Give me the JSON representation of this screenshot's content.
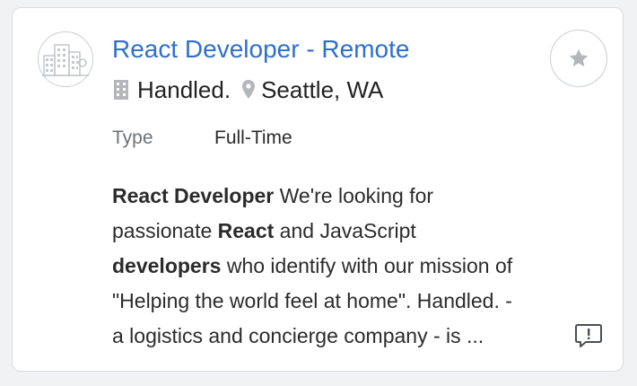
{
  "job": {
    "title": "React Developer - Remote",
    "company": "Handled.",
    "location": "Seattle, WA",
    "type_label": "Type",
    "type_value": "Full-Time",
    "description_lines": [
      [
        {
          "text": "React Developer",
          "bold": true
        },
        {
          "text": " We're looking for",
          "bold": false
        }
      ],
      [
        {
          "text": "passionate ",
          "bold": false
        },
        {
          "text": "React",
          "bold": true
        },
        {
          "text": " and JavaScript",
          "bold": false
        }
      ],
      [
        {
          "text": "developers",
          "bold": true
        },
        {
          "text": " who identify with our mission of",
          "bold": false
        }
      ],
      [
        {
          "text": "\"Helping the world feel at home\". Handled. -",
          "bold": false
        }
      ],
      [
        {
          "text": "a logistics and concierge company - is ...",
          "bold": false
        }
      ]
    ]
  },
  "icons": {
    "logo": "company-building-logo-icon",
    "company": "building-icon",
    "location": "map-pin-icon",
    "favorite": "star-icon",
    "feedback": "comment-exclamation-icon"
  },
  "colors": {
    "title": "#2f6fd0",
    "icon_gray": "#b3b7bc",
    "border": "#d8dadd"
  }
}
